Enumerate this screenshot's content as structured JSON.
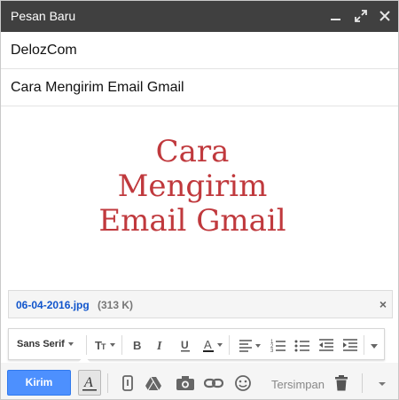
{
  "window": {
    "title": "Pesan Baru",
    "controls": [
      "minimize-icon",
      "expand-icon",
      "close-icon"
    ]
  },
  "compose": {
    "to_value": "DelozCom",
    "subject_value": "Cara Mengirim Email Gmail",
    "body_lines": [
      "Cara",
      "Mengirim",
      "Email Gmail"
    ],
    "body_color": "#c0393d"
  },
  "attachment": {
    "name": "06-04-2016.jpg",
    "size": "(313 K)",
    "close_label": "×"
  },
  "formatting": {
    "font": "Sans Serif",
    "icons": [
      "text-size-icon",
      "bold-icon",
      "italic-icon",
      "underline-icon",
      "text-color-icon",
      "align-icon",
      "numbered-list-icon",
      "bulleted-list-icon",
      "indent-less-icon",
      "indent-more-icon",
      "more-formatting-icon"
    ]
  },
  "bottom": {
    "send_label": "Kirim",
    "saved_label": "Tersimpan",
    "send_color": "#4d90fe",
    "icons": [
      "formatting-toggle-icon",
      "attach-icon",
      "drive-icon",
      "photo-icon",
      "link-icon",
      "emoji-icon",
      "trash-icon",
      "more-options-icon"
    ]
  }
}
